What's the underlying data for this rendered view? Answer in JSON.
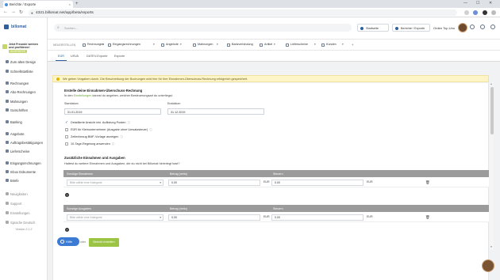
{
  "browser": {
    "tab_title": "Berichte / Exporte",
    "tab_close": "×",
    "new_tab": "+",
    "minimize": "—",
    "maximize": "☐",
    "close": "✕",
    "back": "←",
    "forward": "→",
    "reload": "↻",
    "url": "4321.billomat.net/app/beta/reports"
  },
  "sidebar": {
    "brand": "billomat",
    "promo_line1": "Jetzt Freunde werben",
    "promo_line2": "und profitieren!",
    "promo_badge": "ANGEBOTE",
    "items": [
      {
        "label": "Zum alten Design"
      },
      {
        "label": "Schnellstartliste"
      },
      {
        "label": "Rechnungen"
      },
      {
        "label": "Abo-Rechnungen"
      },
      {
        "label": "Mahnungen"
      },
      {
        "label": "Gutschriften"
      },
      {
        "label": "Banking"
      },
      {
        "label": "Angebote"
      },
      {
        "label": "Auftragsbestätigungen"
      },
      {
        "label": "Lieferscheine"
      },
      {
        "label": "Eingangsrechnungen"
      },
      {
        "label": "Inbox Dokumente"
      },
      {
        "label": "Briefe"
      },
      {
        "label": "Neuigkeiten"
      },
      {
        "label": "Support"
      },
      {
        "label": "Einstellungen"
      },
      {
        "label": "Sprache Deutsch"
      }
    ],
    "version": "Version 2.1.2"
  },
  "header": {
    "search_placeholder": "Suchen...",
    "btn_start": "Startseite",
    "btn_reports": "Berichte / Exporte",
    "user": "Orden Top Uno"
  },
  "toolbar": {
    "crumb": "NEUERSTELLEN",
    "items": [
      {
        "label": "Rechnungen"
      },
      {
        "label": "Eingangsrechnungen"
      },
      {
        "label": "Angebote"
      },
      {
        "label": "Mahnungen"
      },
      {
        "label": "Bankverbindung"
      },
      {
        "label": "Artikel"
      },
      {
        "label": "Lieferscheine"
      },
      {
        "label": "Kunden"
      }
    ],
    "dropdown": "▾",
    "plus": "+"
  },
  "subtabs": [
    "EÜR",
    "USVA",
    "DATEV-Exporte",
    "Exporte"
  ],
  "alert": "Wir geben Vorgaben durch. Die Beschreibung der Buchungen wird hier für Ihre Einnahmen-Überschuss-Rechnung erfolgreich gespeichert.",
  "form": {
    "title": "Erstelle deine Einnahmen-Überschuss-Rechnung",
    "intro_before": "In den ",
    "intro_link": "Einstellungen",
    "intro_after": " kannst du angeben, welcher Besteuerungsart du unterliegst.",
    "from_label": "Startdatum",
    "from_value": "01.01.2019",
    "to_label": "Enddatum",
    "to_value": "31.12.2019",
    "checkboxes": [
      {
        "label": "Detaillierte Ansicht inkl. Auflistung Posten",
        "checked": true
      },
      {
        "label": "EÜR für Kleinunternehmer (Ausgabe ohne Umsatzsteuer)",
        "checked": false
      },
      {
        "label": "Zeilenbezug BMF-Vorlage anzeigen",
        "checked": false
      },
      {
        "label": "10-Tage-Regelung anwenden",
        "checked": false
      }
    ],
    "check_mark": "✓",
    "info_icon": "ⓘ",
    "extra_title": "Zusätzliche Einnahmen und Ausgaben",
    "extra_text": "Hattest du weitere Einnahmen und Ausgaben, die du nicht bei Billomat hinterlegt hast?",
    "income": {
      "headers": [
        "Sonstige Einnahmen",
        "Betrag (netto)",
        "Steuern"
      ],
      "select_placeholder": "Bitte wähle eine Kategorie",
      "amount": "0,00",
      "currency": "EUR",
      "tax": "0,00",
      "tax_currency": "EUR"
    },
    "expenses": {
      "headers": [
        "Sonstige Ausgaben",
        "Betrag (netto)",
        "Steuern"
      ],
      "select_placeholder": "Bitte wähle eine Kategorie",
      "amount": "0,00",
      "currency": "EUR",
      "tax": "0,00",
      "tax_currency": "EUR"
    },
    "add_symbol": "+",
    "trash_symbol": "🗑",
    "caret": "▾"
  },
  "footer": {
    "help": "Hilfe",
    "cancel": "oder",
    "create": "Bericht erstellen"
  }
}
